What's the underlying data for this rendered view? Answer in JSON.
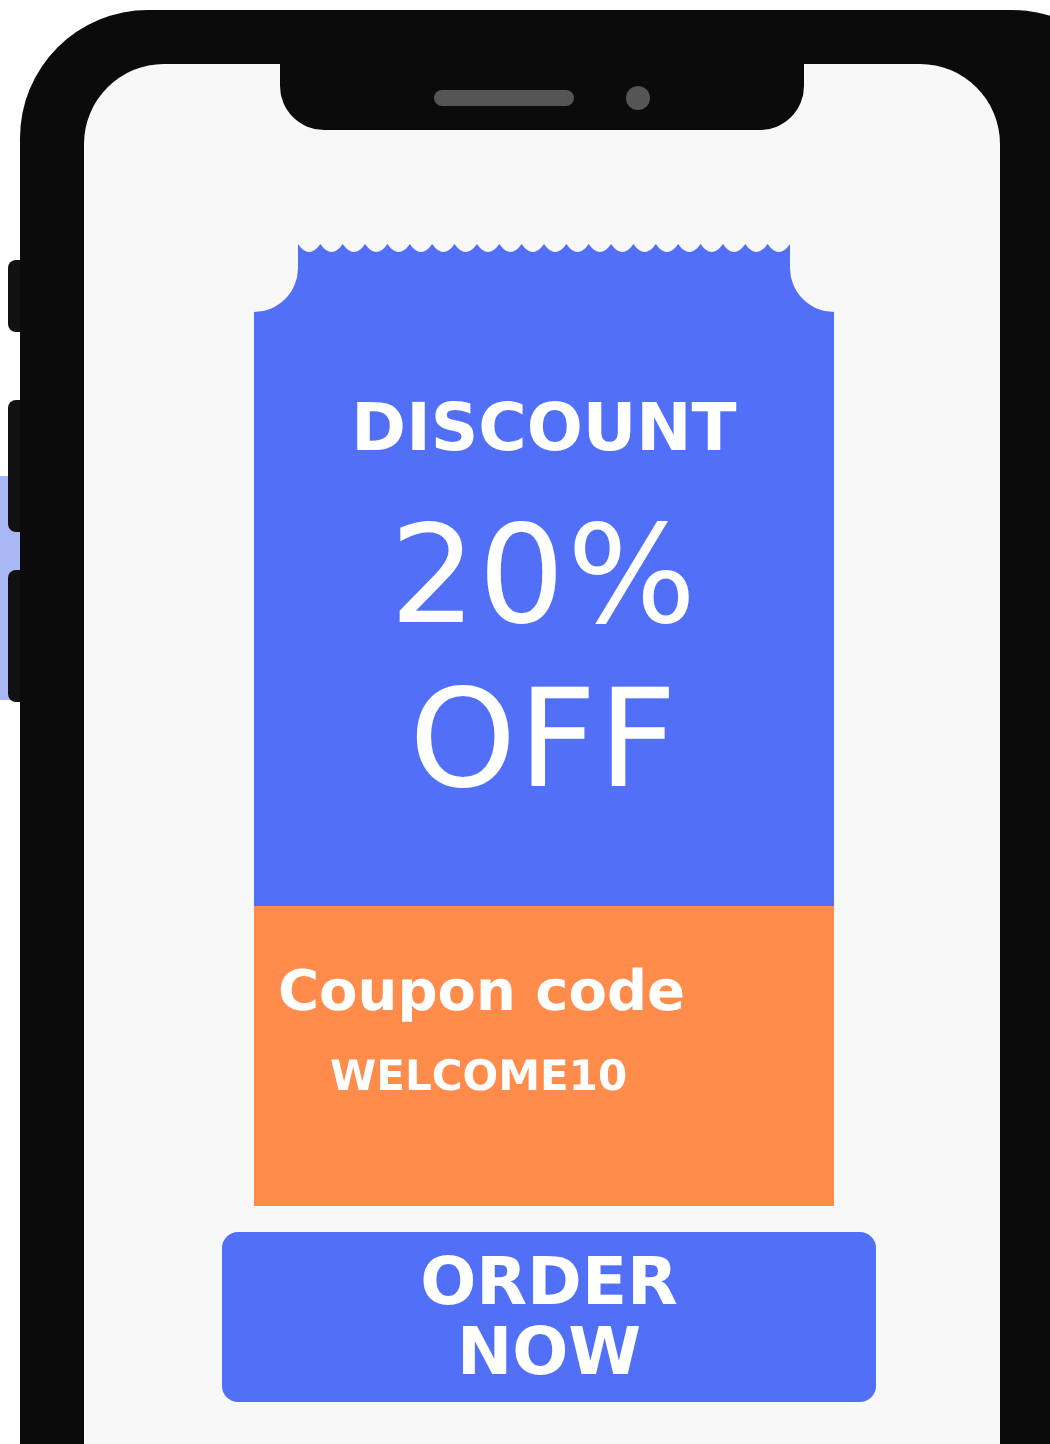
{
  "coupon": {
    "title": "DISCOUNT",
    "amount": "20%",
    "suffix": "OFF",
    "code_label": "Coupon code",
    "code": "WELCOME10"
  },
  "button": {
    "label": "ORDER NOW"
  }
}
